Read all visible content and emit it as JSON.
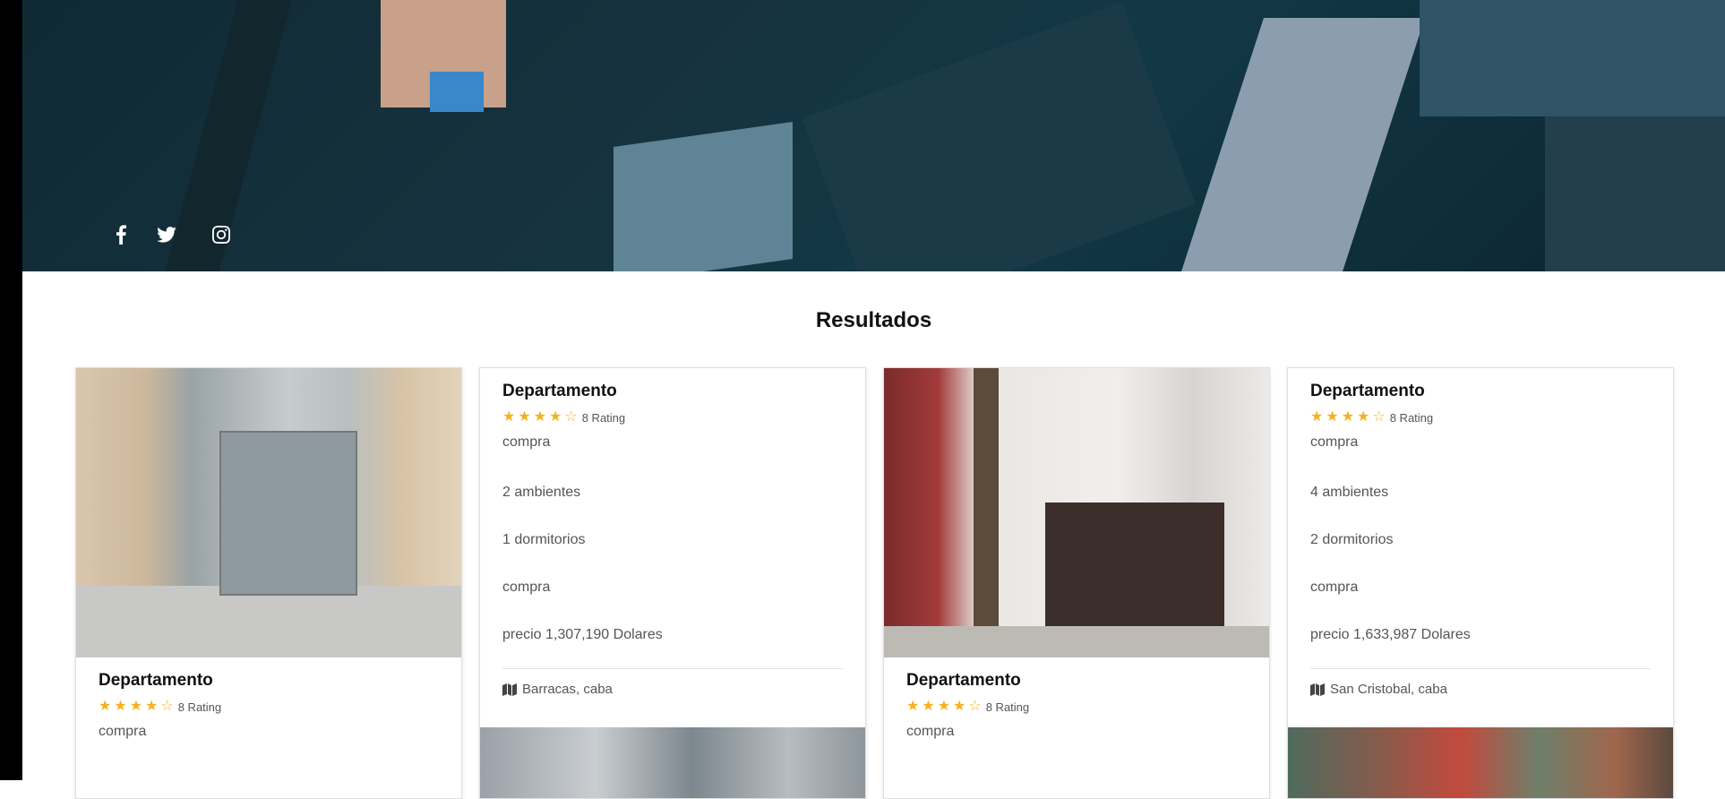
{
  "social": [
    {
      "name": "facebook-icon"
    },
    {
      "name": "twitter-icon"
    },
    {
      "name": "instagram-icon"
    }
  ],
  "results": {
    "heading": "Resultados"
  },
  "cards": [
    {
      "title": "Departamento",
      "rating_text": "8 Rating",
      "stars": 4,
      "lines": [
        "compra"
      ]
    },
    {
      "title": "Departamento",
      "rating_text": "8 Rating",
      "stars": 4,
      "lines": [
        "compra",
        "2 ambientes",
        "1 dormitorios",
        "compra",
        "precio 1,307,190 Dolares"
      ],
      "location": "Barracas, caba"
    },
    {
      "title": "Departamento",
      "rating_text": "8 Rating",
      "stars": 4,
      "lines": [
        "compra"
      ]
    },
    {
      "title": "Departamento",
      "rating_text": "8 Rating",
      "stars": 4,
      "lines": [
        "compra",
        "4 ambientes",
        "2 dormitorios",
        "compra",
        "precio 1,633,987 Dolares"
      ],
      "location": "San Cristobal, caba"
    }
  ],
  "colors": {
    "star": "#f5b120",
    "hero": "#16323e"
  }
}
